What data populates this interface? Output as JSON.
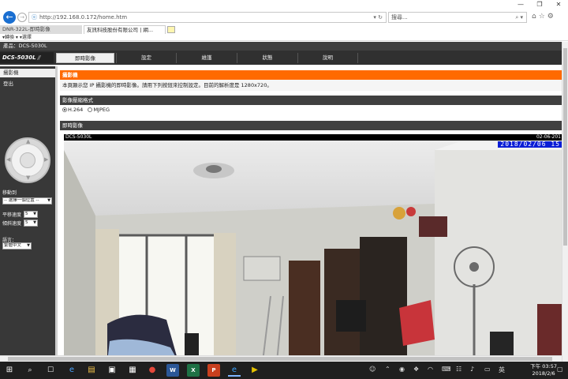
{
  "browser": {
    "url": "http://192.168.0.172/home.htm",
    "search_placeholder": "搜尋...",
    "tabs": [
      {
        "label": "DNR-322L-即時影像"
      },
      {
        "label": "友訊科技股份有限公司 | 網..."
      }
    ],
    "favorites": "▾轉換 ▾ ▾選擇",
    "window_controls": {
      "minimize": "—",
      "maximize": "❐",
      "close": "✕"
    }
  },
  "camera_ui": {
    "product_label": "產品：DCS-5030L",
    "logo": "DCS-5030L",
    "menu": [
      {
        "label": "即時影像",
        "active": true
      },
      {
        "label": "設定",
        "active": false
      },
      {
        "label": "維護",
        "active": false
      },
      {
        "label": "狀態",
        "active": false
      },
      {
        "label": "說明",
        "active": false
      }
    ],
    "sidebar": {
      "live_video": "攝影機",
      "logout": "登出",
      "move_to_label": "移動到",
      "preset_value": "-- 選擇一個位置 --",
      "pan_speed_label": "平移速度",
      "pan_speed_value": "5",
      "tilt_speed_label": "傾斜速度",
      "tilt_speed_value": "5",
      "language_label": "語言：",
      "language_value": "繁體中文"
    },
    "section_title": "攝影機",
    "description": "本頁顯示您 IP 攝影機的即時影像。請用下列按鈕來控制設定。目前的解析度是 1280x720。",
    "format_heading": "影像壓縮格式",
    "codecs": [
      {
        "label": "H.264",
        "selected": true
      },
      {
        "label": "MJPEG",
        "selected": false
      }
    ],
    "live_heading": "即時影像",
    "video": {
      "osd_name": "DCS-5030L",
      "osd_date_small": "02-06-201",
      "osd_datetime": "2018/02/06 15"
    }
  },
  "taskbar": {
    "clock_time": "下午 03:57",
    "clock_date": "2018/2/6"
  },
  "colors": {
    "accent_orange": "#ff6a00",
    "menu_dark": "#303030",
    "osd_blue": "#0a1dd6",
    "ie_blue": "#1a6fd1"
  }
}
